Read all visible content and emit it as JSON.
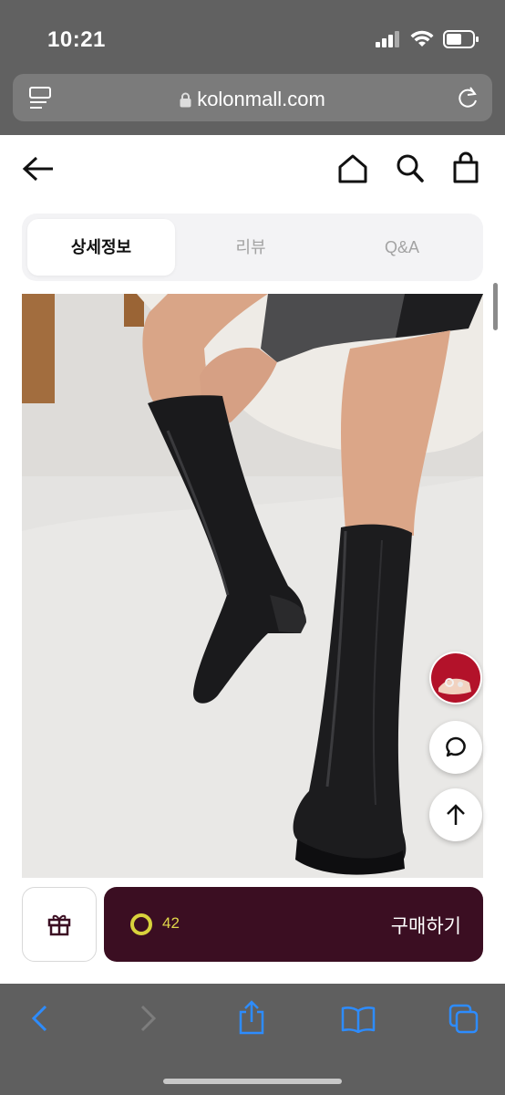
{
  "status_bar": {
    "time": "10:21"
  },
  "browser": {
    "url": "kolonmall.com"
  },
  "tabs": [
    {
      "label": "상세정보",
      "active": true
    },
    {
      "label": "리뷰",
      "active": false
    },
    {
      "label": "Q&A",
      "active": false
    }
  ],
  "purchase": {
    "like_count": "42",
    "buy_label": "구매하기"
  },
  "colors": {
    "buy_button": "#3b0e22",
    "like_ring": "#d8d23c",
    "safari_blue": "#2d8cff"
  },
  "icons": [
    "back-arrow-icon",
    "home-icon",
    "search-icon",
    "cart-icon",
    "chat-icon",
    "arrow-up-icon",
    "gift-icon",
    "share-icon",
    "bookmarks-icon",
    "tabs-icon"
  ]
}
